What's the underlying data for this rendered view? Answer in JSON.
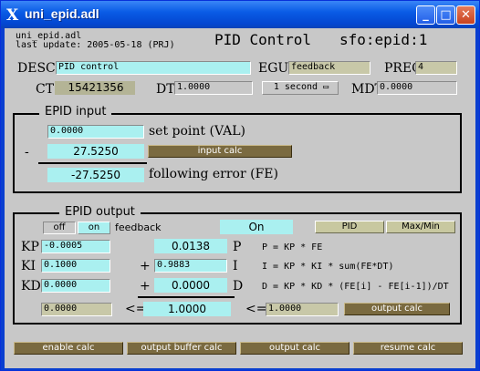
{
  "window": {
    "title": "uni_epid.adl"
  },
  "header": {
    "file_name": "uni_epid.adl",
    "last_update": "last update: 2005-05-18 (PRJ)",
    "title": "PID Control",
    "pv_prefix": "sfo:epid:1"
  },
  "row1": {
    "desc_label": "DESC",
    "desc_value": "PID control",
    "egu_label": "EGU",
    "egu_value": "feedback",
    "prec_label": "PREC",
    "prec_value": "4"
  },
  "row2": {
    "ct_label": "CT",
    "ct_value": "15421356",
    "dt_label": "DT",
    "dt_value": "1.0000",
    "scan_value": "1 second",
    "mdt_label": "MDT",
    "mdt_value": "0.0000"
  },
  "input": {
    "title": "EPID input",
    "setpoint_value": "0.0000",
    "setpoint_label": "set point (VAL)",
    "minus": "-",
    "cval_value": "27.5250",
    "input_calc_label": "input calc",
    "error_value": "-27.5250",
    "error_label": "following error (FE)"
  },
  "output": {
    "title": "EPID output",
    "off_label": "off",
    "on_label": "on",
    "feedback_label": "feedback",
    "feedback_state": "On",
    "pid_label": "PID",
    "maxmin_label": "Max/Min",
    "kp_label": "KP",
    "kp_value": "-0.0005",
    "ki_label": "KI",
    "ki_value": "0.1000",
    "kd_label": "KD",
    "kd_value": "0.0000",
    "p_value": "0.0138",
    "p_label": "P",
    "p_formula": "P = KP * FE",
    "plus_i": "+",
    "i_value": "0.9883",
    "i_label": "I",
    "i_formula": "I = KP * KI * sum(FE*DT)",
    "plus_d": "+",
    "d_value": "0.0000",
    "d_label": "D",
    "d_formula": "D = KP * KD * (FE[i] - FE[i-1])/DT",
    "low_value": "0.0000",
    "le1": "<=",
    "output_value": "1.0000",
    "le2": "<=",
    "high_value": "1.0000",
    "output_calc_label": "output calc"
  },
  "footer": {
    "enable_calc": "enable calc",
    "output_buffer_calc": "output buffer calc",
    "output_calc": "output calc",
    "resume_calc": "resume calc"
  }
}
